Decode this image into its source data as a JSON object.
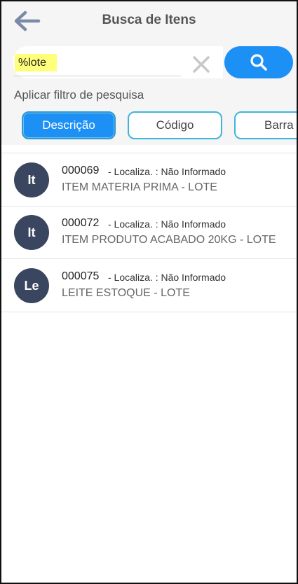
{
  "header": {
    "title": "Busca de Itens",
    "back_icon": "arrow-left-icon"
  },
  "search": {
    "value": "%lote",
    "clear_icon": "close-icon",
    "button_icon": "search-icon"
  },
  "filter": {
    "label": "Aplicar filtro de pesquisa",
    "options": [
      {
        "label": "Descrição",
        "selected": true
      },
      {
        "label": "Código",
        "selected": false
      },
      {
        "label": "Barra",
        "selected": false
      }
    ]
  },
  "items": [
    {
      "initials": "It",
      "code": "000069",
      "location": "-  Localiza. : Não Informado",
      "description": "ITEM MATERIA PRIMA - LOTE"
    },
    {
      "initials": "It",
      "code": "000072",
      "location": "-  Localiza. : Não Informado",
      "description": "ITEM PRODUTO ACABADO 20KG - LOTE"
    },
    {
      "initials": "Le",
      "code": "000075",
      "location": "-  Localiza. : Não Informado",
      "description": "LEITE ESTOQUE - LOTE"
    }
  ],
  "colors": {
    "accent": "#1d90f5",
    "chip_border": "#3eb6dc",
    "avatar": "#3a4660",
    "highlight": "#ffff7a"
  }
}
